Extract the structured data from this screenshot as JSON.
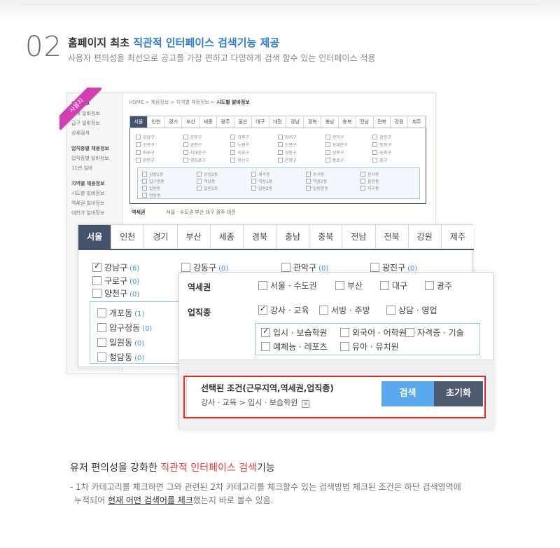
{
  "header": {
    "number": "02",
    "title_prefix": "홈페이지 최초 ",
    "title_accent": "직관적 인터페이스 검색기능 제공",
    "subtitle": "사용자 편의성을 최선으로 공고를 가장 편하고 다양하게 검색 할수 있는 인터페이스 적용"
  },
  "ribbon_label": "사용자",
  "background_window": {
    "sidebar": [
      "채용정보",
      "전체 일바정보",
      "급구 일바정보",
      "상세검색",
      "업직종별 채용정보",
      "업직종별 일바정보",
      "11번 일바",
      "지역별 채용정보",
      "시도별 일바정보",
      "역세권 일바정보",
      "대학가 일바정보"
    ],
    "breadcrumb": "HOME > 채용정보 > 지역별 채용정보 > ",
    "breadcrumb_current": "시도별 알바정보",
    "tabs": [
      "서울",
      "인천",
      "경기",
      "부산",
      "세종",
      "광주",
      "울산",
      "대구",
      "대전",
      "경남",
      "경북",
      "충남",
      "충북",
      "전남",
      "전북",
      "강원",
      "제주"
    ],
    "districts": [
      [
        "강남구",
        "강동구",
        "강북구",
        "강서구",
        "관악구",
        "광진구"
      ],
      [
        "구로구",
        "금천구",
        "노원구",
        "도봉구",
        "동대문구",
        "동작구"
      ],
      [
        "마포구",
        "서대문구",
        "서초구",
        "성동구",
        "성북구",
        "송파구"
      ],
      [
        "양천구",
        "영등포구",
        "용산구",
        "은평구",
        "종로구",
        "중구"
      ]
    ],
    "dongs": [
      [
        "삼성1동",
        "삼성2동",
        "세곡동",
        "수서동",
        "신사동"
      ],
      [
        "압구정동",
        "역삼동",
        "역삼1동",
        "역삼2동",
        "율현동"
      ],
      [
        "일원동",
        "일원1동",
        "일원2동",
        "일원본동",
        "자곡동"
      ],
      [
        "청담동"
      ]
    ],
    "region_label": "역세권",
    "region_options": "서울 · 수도권   부산   대구   광주   대전"
  },
  "city_panel": {
    "tabs": [
      "서울",
      "인천",
      "경기",
      "부산",
      "세종",
      "경북",
      "충남",
      "충북",
      "전남",
      "전북",
      "강원",
      "제주"
    ],
    "active_tab": "서울",
    "districts": [
      {
        "name": "강남구",
        "count": "(6)",
        "checked": true
      },
      {
        "name": "강동구",
        "count": "(0)",
        "checked": false
      },
      {
        "name": "관악구",
        "count": "(0)",
        "checked": false
      },
      {
        "name": "광진구",
        "count": "(0)",
        "checked": false
      },
      {
        "name": "구로구",
        "count": "(0)",
        "checked": false
      },
      {
        "name": "양천구",
        "count": "(0)",
        "checked": false
      }
    ],
    "dongs": [
      {
        "name": "개포동",
        "count": "(1)"
      },
      {
        "name": "압구정동",
        "count": "(0)"
      },
      {
        "name": "일원동",
        "count": "(0)"
      },
      {
        "name": "청담동",
        "count": "(0)"
      }
    ]
  },
  "filter_panel": {
    "station_label": "역세권",
    "station_options": [
      "서울 · 수도권",
      "부산",
      "대구",
      "광주"
    ],
    "job_label": "업직종",
    "job_options": [
      {
        "label": "강사 · 교육",
        "checked": true
      },
      {
        "label": "서빙 · 주방",
        "checked": false
      },
      {
        "label": "상담 · 영업",
        "checked": false
      }
    ],
    "job_sub_options": [
      {
        "label": "입시 · 보습학원",
        "checked": true
      },
      {
        "label": "외국어 · 어학원",
        "checked": false
      },
      {
        "label": "자격증 · 기술",
        "checked": false
      },
      {
        "label": "예체능 · 레포츠",
        "checked": false
      },
      {
        "label": "유아 · 유치원",
        "checked": false
      }
    ],
    "selected_title": "선택된 조건(근무지역,역세권,업직종)",
    "selected_path": "강사 · 교육 > 입시 · 보습학원",
    "remove_glyph": "✕",
    "search_button": "검색",
    "reset_button": "초기화"
  },
  "footer": {
    "title_prefix": "유저 편의성을 강화한 ",
    "title_accent": "직관적 인터페이스 검색",
    "title_suffix": "기능",
    "desc_line1": "- 1차 카테고리를 체크하면 그와 관련된 2차 카테고리를 체크할수 있는 검색방법 체크된 조건은 하단 검색영역에",
    "desc_line2_prefix": "누적되어 ",
    "desc_line2_highlight": "현재 어떤 검색어를 체크",
    "desc_line2_suffix": "했는지 바로 볼수 있음."
  },
  "colors": {
    "accent_blue": "#2c7ed6",
    "accent_red": "#e63b3b",
    "tab_active": "#44526b",
    "search_button": "#5aa9ee",
    "reset_button": "#4d5a6f",
    "ribbon": "#d33fb0"
  }
}
